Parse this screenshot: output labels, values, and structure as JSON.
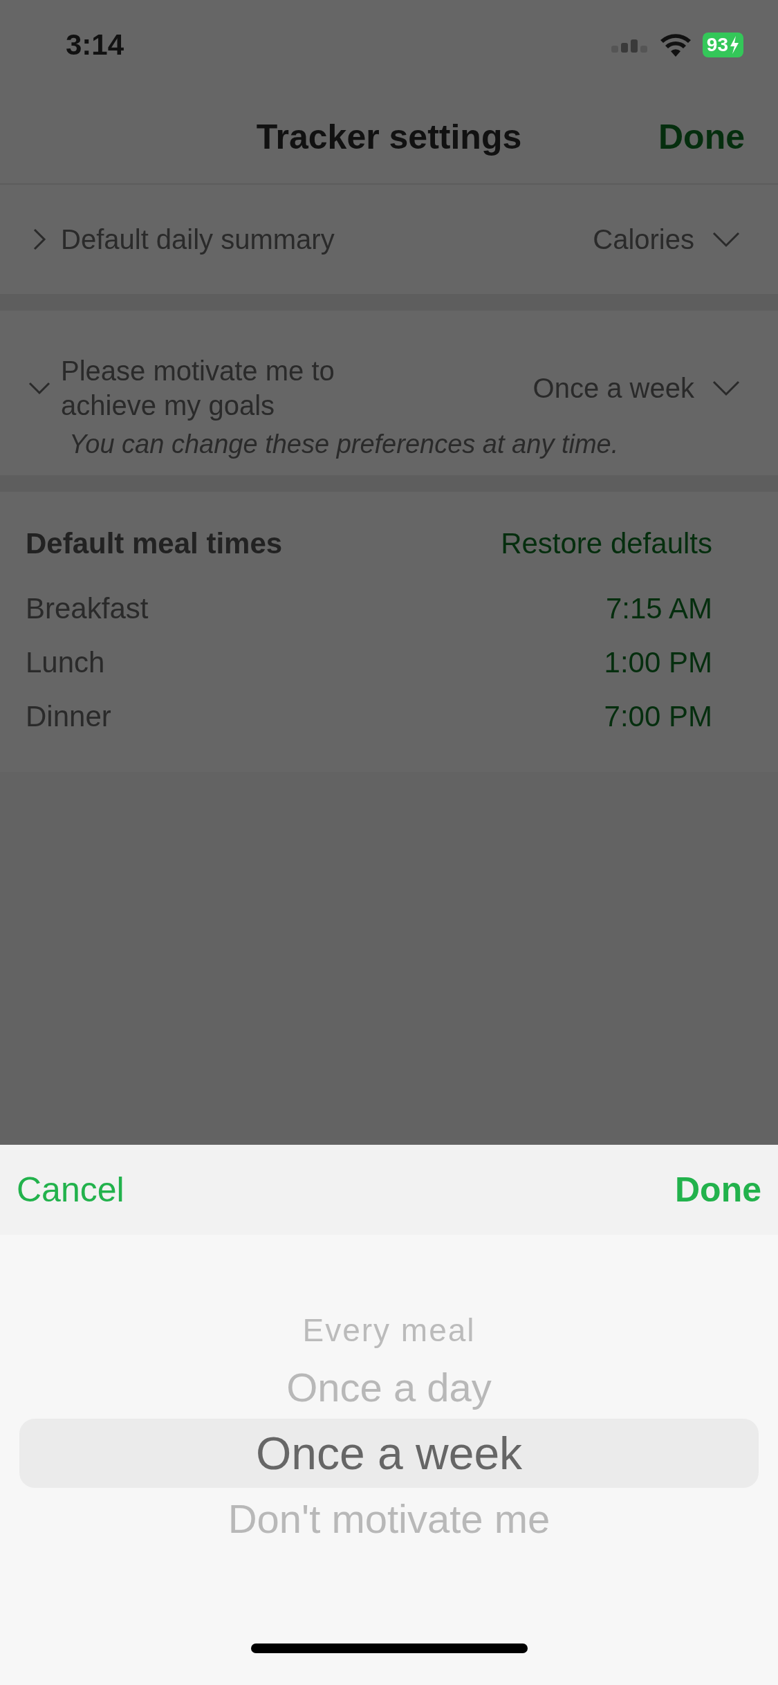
{
  "status_bar": {
    "time": "3:14",
    "battery": "93"
  },
  "nav": {
    "title": "Tracker settings",
    "done": "Done"
  },
  "settings": [
    {
      "label": "Default daily summary",
      "value": "Calories",
      "expanded": false
    },
    {
      "label": "Please motivate me to achieve my goals",
      "value": "Once a week",
      "expanded": true,
      "note": "You can change these preferences at any time."
    }
  ],
  "meal_times": {
    "title": "Default meal times",
    "restore": "Restore defaults",
    "rows": [
      {
        "meal": "Breakfast",
        "time": "7:15 AM"
      },
      {
        "meal": "Lunch",
        "time": "1:00 PM"
      },
      {
        "meal": "Dinner",
        "time": "7:00 PM"
      }
    ]
  },
  "sheet": {
    "cancel": "Cancel",
    "done": "Done",
    "options": [
      {
        "label": "Every meal",
        "selected": false
      },
      {
        "label": "Once a day",
        "selected": false
      },
      {
        "label": "Once a week",
        "selected": true
      },
      {
        "label": "Don't motivate me",
        "selected": false
      }
    ]
  }
}
